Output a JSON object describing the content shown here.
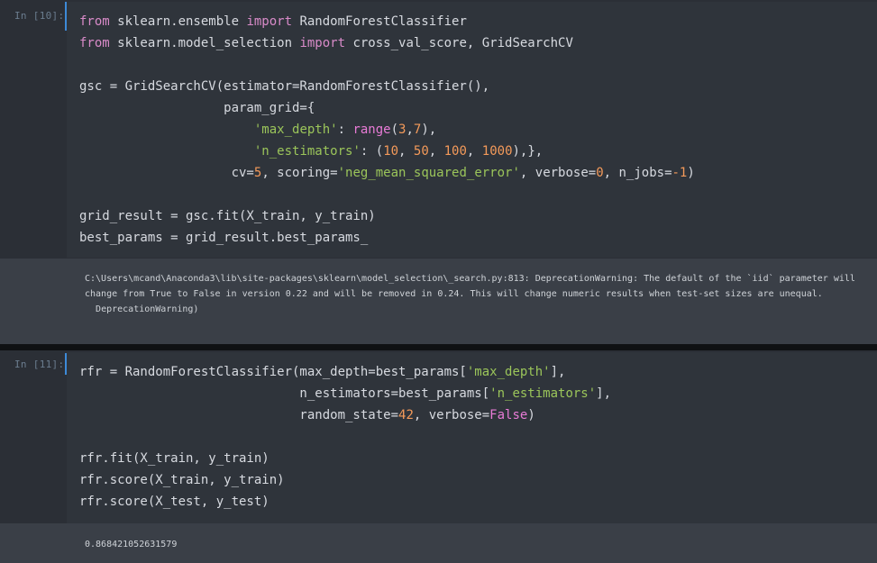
{
  "cells": {
    "c10": {
      "prompt": "In [10]:",
      "output": "C:\\Users\\mcand\\Anaconda3\\lib\\site-packages\\sklearn\\model_selection\\_search.py:813: DeprecationWarning: The default of the `iid` parameter will change from True to False in version 0.22 and will be removed in 0.24. This will change numeric results when test-set sizes are unequal.\n  DeprecationWarning)"
    },
    "c11": {
      "prompt": "In [11]:",
      "output": "0.868421052631579"
    }
  },
  "code": {
    "c10": [
      [
        [
          "k",
          "from"
        ],
        [
          "t",
          " sklearn.ensemble "
        ],
        [
          "k",
          "import"
        ],
        [
          "t",
          " RandomForestClassifier"
        ]
      ],
      [
        [
          "k",
          "from"
        ],
        [
          "t",
          " sklearn.model_selection "
        ],
        [
          "k",
          "import"
        ],
        [
          "t",
          " cross_val_score, GridSearchCV"
        ]
      ],
      [],
      [
        [
          "t",
          "gsc = GridSearchCV(estimator=RandomForestClassifier(),"
        ]
      ],
      [
        [
          "t",
          "                   param_grid={"
        ]
      ],
      [
        [
          "t",
          "                       "
        ],
        [
          "s",
          "'max_depth'"
        ],
        [
          "t",
          ": "
        ],
        [
          "bi",
          "range"
        ],
        [
          "t",
          "("
        ],
        [
          "n",
          "3"
        ],
        [
          "t",
          ","
        ],
        [
          "n",
          "7"
        ],
        [
          "t",
          "),"
        ]
      ],
      [
        [
          "t",
          "                       "
        ],
        [
          "s",
          "'n_estimators'"
        ],
        [
          "t",
          ": ("
        ],
        [
          "n",
          "10"
        ],
        [
          "t",
          ", "
        ],
        [
          "n",
          "50"
        ],
        [
          "t",
          ", "
        ],
        [
          "n",
          "100"
        ],
        [
          "t",
          ", "
        ],
        [
          "n",
          "1000"
        ],
        [
          "t",
          "),},"
        ]
      ],
      [
        [
          "t",
          "                    cv="
        ],
        [
          "n",
          "5"
        ],
        [
          "t",
          ", scoring="
        ],
        [
          "s",
          "'neg_mean_squared_error'"
        ],
        [
          "t",
          ", verbose="
        ],
        [
          "n",
          "0"
        ],
        [
          "t",
          ", n_jobs="
        ],
        [
          "n",
          "-1"
        ],
        [
          "t",
          ")"
        ]
      ],
      [],
      [
        [
          "t",
          "grid_result = gsc.fit(X_train, y_train)"
        ]
      ],
      [
        [
          "t",
          "best_params = grid_result.best_params_"
        ]
      ]
    ],
    "c11": [
      [
        [
          "t",
          "rfr = RandomForestClassifier(max_depth=best_params["
        ],
        [
          "s",
          "'max_depth'"
        ],
        [
          "t",
          "],"
        ]
      ],
      [
        [
          "t",
          "                             n_estimators=best_params["
        ],
        [
          "s",
          "'n_estimators'"
        ],
        [
          "t",
          "],"
        ]
      ],
      [
        [
          "t",
          "                             random_state="
        ],
        [
          "n",
          "42"
        ],
        [
          "t",
          ", verbose="
        ],
        [
          "bi",
          "False"
        ],
        [
          "t",
          ")"
        ]
      ],
      [],
      [
        [
          "t",
          "rfr.fit(X_train, y_train)"
        ]
      ],
      [
        [
          "t",
          "rfr.score(X_train, y_train)"
        ]
      ],
      [
        [
          "t",
          "rfr.score(X_test, y_test)"
        ]
      ]
    ]
  }
}
